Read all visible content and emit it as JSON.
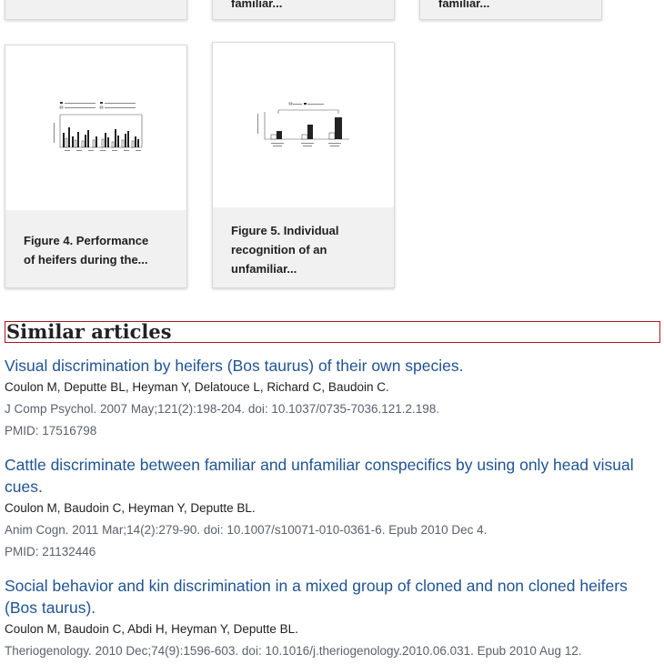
{
  "figures": [
    {
      "caption_lines": [
        "familiar..."
      ]
    },
    {
      "caption_lines": [
        "familiar..."
      ]
    },
    {
      "caption_lines": [
        "Figure 4. Performance",
        "of heifers during the..."
      ]
    },
    {
      "caption_lines": [
        "Figure 5. Individual",
        "recognition of an",
        "unfamiliar..."
      ]
    }
  ],
  "similar": {
    "heading": "Similar articles",
    "articles": [
      {
        "title_lines": [
          "Visual discrimination by heifers (Bos taurus) of their own species."
        ],
        "authors": "Coulon M, Deputte BL, Heyman Y, Delatouce L, Richard C, Baudoin C.",
        "citation": "J Comp Psychol. 2007 May;121(2):198-204. doi: 10.1037/0735-7036.121.2.198.",
        "pmid": "PMID: 17516798"
      },
      {
        "title_lines": [
          "Cattle discriminate between familiar and unfamiliar conspecifics by using only head visual",
          "cues."
        ],
        "authors": "Coulon M, Baudoin C, Heyman Y, Deputte BL.",
        "citation": "Anim Cogn. 2011 Mar;14(2):279-90. doi: 10.1007/s10071-010-0361-6. Epub 2010 Dec 4.",
        "pmid": "PMID: 21132446"
      },
      {
        "title_lines": [
          "Social behavior and kin discrimination in a mixed group of cloned and non cloned heifers",
          "(Bos taurus)."
        ],
        "authors": "Coulon M, Baudoin C, Abdi H, Heyman Y, Deputte BL.",
        "citation": "Theriogenology. 2010 Dec;74(9):1596-603. doi: 10.1016/j.theriogenology.2010.06.031. Epub 2010 Aug 12."
      }
    ]
  }
}
